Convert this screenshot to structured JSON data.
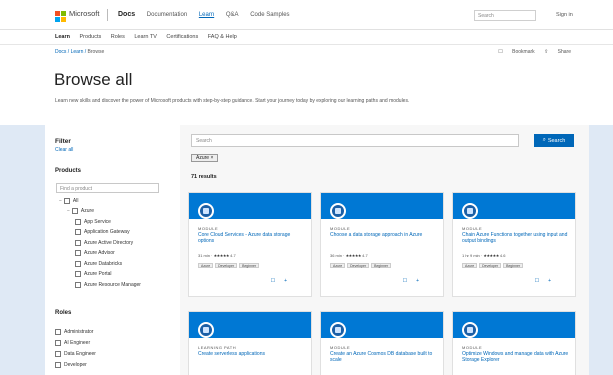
{
  "header": {
    "brand": "Microsoft",
    "nav": [
      "Docs",
      "Documentation",
      "Learn",
      "Q&A",
      "Code Samples"
    ],
    "active_nav": "Learn",
    "search_placeholder": "Search",
    "signin": "Sign in"
  },
  "subnav": [
    "Learn",
    "Products",
    "Roles",
    "Learn TV",
    "Certifications",
    "FAQ & Help"
  ],
  "breadcrumb": [
    "Docs",
    "Learn",
    "Browse"
  ],
  "hero_actions": [
    "Bookmark",
    "Share"
  ],
  "page": {
    "title": "Browse all",
    "description": "Learn new skills and discover the power of Microsoft products with step-by-step guidance. Start your journey today by exploring our learning paths and modules."
  },
  "filter": {
    "title": "Filter",
    "clear": "Clear all",
    "products_title": "Products",
    "product_search_placeholder": "Find a product",
    "products": [
      {
        "label": "All",
        "level": 0,
        "caret": true
      },
      {
        "label": "Azure",
        "level": 1,
        "caret": true
      },
      {
        "label": "App Service",
        "level": 2,
        "caret": false
      },
      {
        "label": "Application Gateway",
        "level": 2,
        "caret": false
      },
      {
        "label": "Azure Active Directory",
        "level": 2,
        "caret": false
      },
      {
        "label": "Azure Advisor",
        "level": 2,
        "caret": false
      },
      {
        "label": "Azure Databricks",
        "level": 2,
        "caret": false
      },
      {
        "label": "Azure Portal",
        "level": 2,
        "caret": false
      },
      {
        "label": "Azure Resource Manager",
        "level": 2,
        "caret": false
      }
    ],
    "roles_title": "Roles",
    "roles": [
      "Administrator",
      "AI Engineer",
      "Data Engineer",
      "Developer"
    ]
  },
  "search": {
    "placeholder": "Search",
    "button": "Search",
    "chip": "Azure ×"
  },
  "results_label": "71 results",
  "cards": [
    {
      "type": "MODULE",
      "title": "Core Cloud Services - Azure data storage options",
      "duration": "31 min",
      "rating": "4.7",
      "stars": "★★★★★",
      "tags": [
        "Azure",
        "Developer",
        "Beginner"
      ]
    },
    {
      "type": "MODULE",
      "title": "Choose a data storage approach in Azure",
      "duration": "36 min",
      "rating": "4.7",
      "stars": "★★★★★",
      "tags": [
        "Azure",
        "Developer",
        "Beginner"
      ]
    },
    {
      "type": "MODULE",
      "title": "Chain Azure Functions together using input and output bindings",
      "duration": "1 hr 9 min",
      "rating": "4.6",
      "stars": "★★★★★",
      "tags": [
        "Azure",
        "Developer",
        "Beginner"
      ]
    },
    {
      "type": "LEARNING PATH",
      "title": "Create serverless applications",
      "duration": "",
      "rating": "",
      "stars": "",
      "tags": []
    },
    {
      "type": "MODULE",
      "title": "Create an Azure Cosmos DB database built to scale",
      "duration": "",
      "rating": "",
      "stars": "",
      "tags": []
    },
    {
      "type": "MODULE",
      "title": "Optimize Windows and manage data with Azure Storage Explorer",
      "duration": "",
      "rating": "",
      "stars": "",
      "tags": []
    }
  ],
  "card_actions": [
    "Bookmark",
    "Add"
  ],
  "colors": {
    "accent": "#0067b8",
    "banner": "#0078d4",
    "background": "#dfe9f5"
  }
}
